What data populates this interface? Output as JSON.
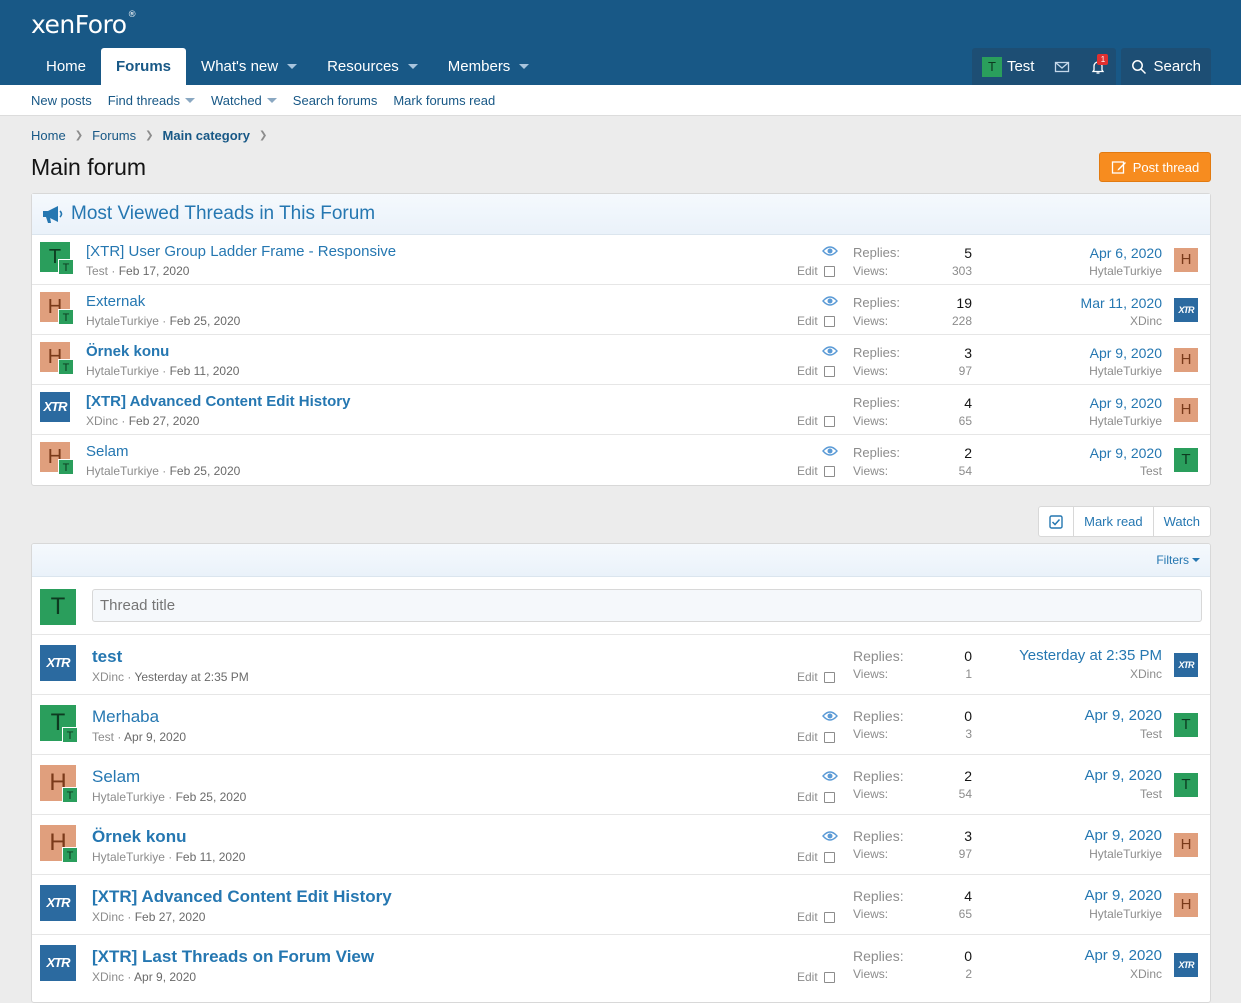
{
  "header": {
    "logo": "xenForo",
    "nav": [
      {
        "label": "Home",
        "caret": false,
        "selected": false
      },
      {
        "label": "Forums",
        "caret": false,
        "selected": true
      },
      {
        "label": "What's new",
        "caret": true,
        "selected": false
      },
      {
        "label": "Resources",
        "caret": true,
        "selected": false
      },
      {
        "label": "Members",
        "caret": true,
        "selected": false
      }
    ],
    "user": {
      "initial": "T",
      "name": "Test"
    },
    "alert_count": "1",
    "search_label": "Search"
  },
  "subnav": [
    {
      "label": "New posts",
      "caret": false
    },
    {
      "label": "Find threads",
      "caret": true
    },
    {
      "label": "Watched",
      "caret": true
    },
    {
      "label": "Search forums",
      "caret": false
    },
    {
      "label": "Mark forums read",
      "caret": false
    }
  ],
  "breadcrumbs": [
    "Home",
    "Forums",
    "Main category"
  ],
  "page_title": "Main forum",
  "post_thread_label": "Post thread",
  "most_viewed": {
    "title": "Most Viewed Threads in This Forum",
    "threads": [
      {
        "av": "T",
        "sub": "T",
        "title": "[XTR] User Group Ladder Frame - Responsive",
        "bold": false,
        "author": "Test",
        "date": "Feb 17, 2020",
        "watched": true,
        "replies": "5",
        "views": "303",
        "last_date": "Apr 6, 2020",
        "last_user": "HytaleTurkiye",
        "last_av": "H"
      },
      {
        "av": "H",
        "sub": "T",
        "title": "Externak",
        "bold": false,
        "author": "HytaleTurkiye",
        "date": "Feb 25, 2020",
        "watched": true,
        "replies": "19",
        "views": "228",
        "last_date": "Mar 11, 2020",
        "last_user": "XDinc",
        "last_av": "X"
      },
      {
        "av": "H",
        "sub": "T",
        "title": "Örnek konu",
        "bold": true,
        "author": "HytaleTurkiye",
        "date": "Feb 11, 2020",
        "watched": true,
        "replies": "3",
        "views": "97",
        "last_date": "Apr 9, 2020",
        "last_user": "HytaleTurkiye",
        "last_av": "H"
      },
      {
        "av": "X",
        "sub": "",
        "title": "[XTR] Advanced Content Edit History",
        "bold": true,
        "author": "XDinc",
        "date": "Feb 27, 2020",
        "watched": false,
        "replies": "4",
        "views": "65",
        "last_date": "Apr 9, 2020",
        "last_user": "HytaleTurkiye",
        "last_av": "H"
      },
      {
        "av": "H",
        "sub": "T",
        "title": "Selam",
        "bold": false,
        "author": "HytaleTurkiye",
        "date": "Feb 25, 2020",
        "watched": true,
        "replies": "2",
        "views": "54",
        "last_date": "Apr 9, 2020",
        "last_user": "Test",
        "last_av": "T"
      }
    ]
  },
  "labels": {
    "replies": "Replies:",
    "views": "Views:",
    "edit": "Edit",
    "dot": " · ",
    "xtr": "XTR"
  },
  "actions": {
    "mark_read": "Mark read",
    "watch": "Watch"
  },
  "filters_label": "Filters",
  "thread_title_placeholder": "Thread title",
  "quick_user_initial": "T",
  "threads": [
    {
      "av": "X",
      "sub": "",
      "title": "test",
      "bold": true,
      "author": "XDinc",
      "date": "Yesterday at 2:35 PM",
      "watched": false,
      "replies": "0",
      "views": "1",
      "last_date": "Yesterday at 2:35 PM",
      "last_user": "XDinc",
      "last_av": "X"
    },
    {
      "av": "T",
      "sub": "T",
      "title": "Merhaba",
      "bold": false,
      "author": "Test",
      "date": "Apr 9, 2020",
      "watched": true,
      "replies": "0",
      "views": "3",
      "last_date": "Apr 9, 2020",
      "last_user": "Test",
      "last_av": "T"
    },
    {
      "av": "H",
      "sub": "T",
      "title": "Selam",
      "bold": false,
      "author": "HytaleTurkiye",
      "date": "Feb 25, 2020",
      "watched": true,
      "replies": "2",
      "views": "54",
      "last_date": "Apr 9, 2020",
      "last_user": "Test",
      "last_av": "T"
    },
    {
      "av": "H",
      "sub": "T",
      "title": "Örnek konu",
      "bold": true,
      "author": "HytaleTurkiye",
      "date": "Feb 11, 2020",
      "watched": true,
      "replies": "3",
      "views": "97",
      "last_date": "Apr 9, 2020",
      "last_user": "HytaleTurkiye",
      "last_av": "H"
    },
    {
      "av": "X",
      "sub": "",
      "title": "[XTR] Advanced Content Edit History",
      "bold": true,
      "author": "XDinc",
      "date": "Feb 27, 2020",
      "watched": false,
      "replies": "4",
      "views": "65",
      "last_date": "Apr 9, 2020",
      "last_user": "HytaleTurkiye",
      "last_av": "H"
    },
    {
      "av": "X",
      "sub": "",
      "title": "[XTR] Last Threads on Forum View",
      "bold": true,
      "author": "XDinc",
      "date": "Apr 9, 2020",
      "watched": false,
      "replies": "0",
      "views": "2",
      "last_date": "Apr 9, 2020",
      "last_user": "XDinc",
      "last_av": "X"
    }
  ]
}
